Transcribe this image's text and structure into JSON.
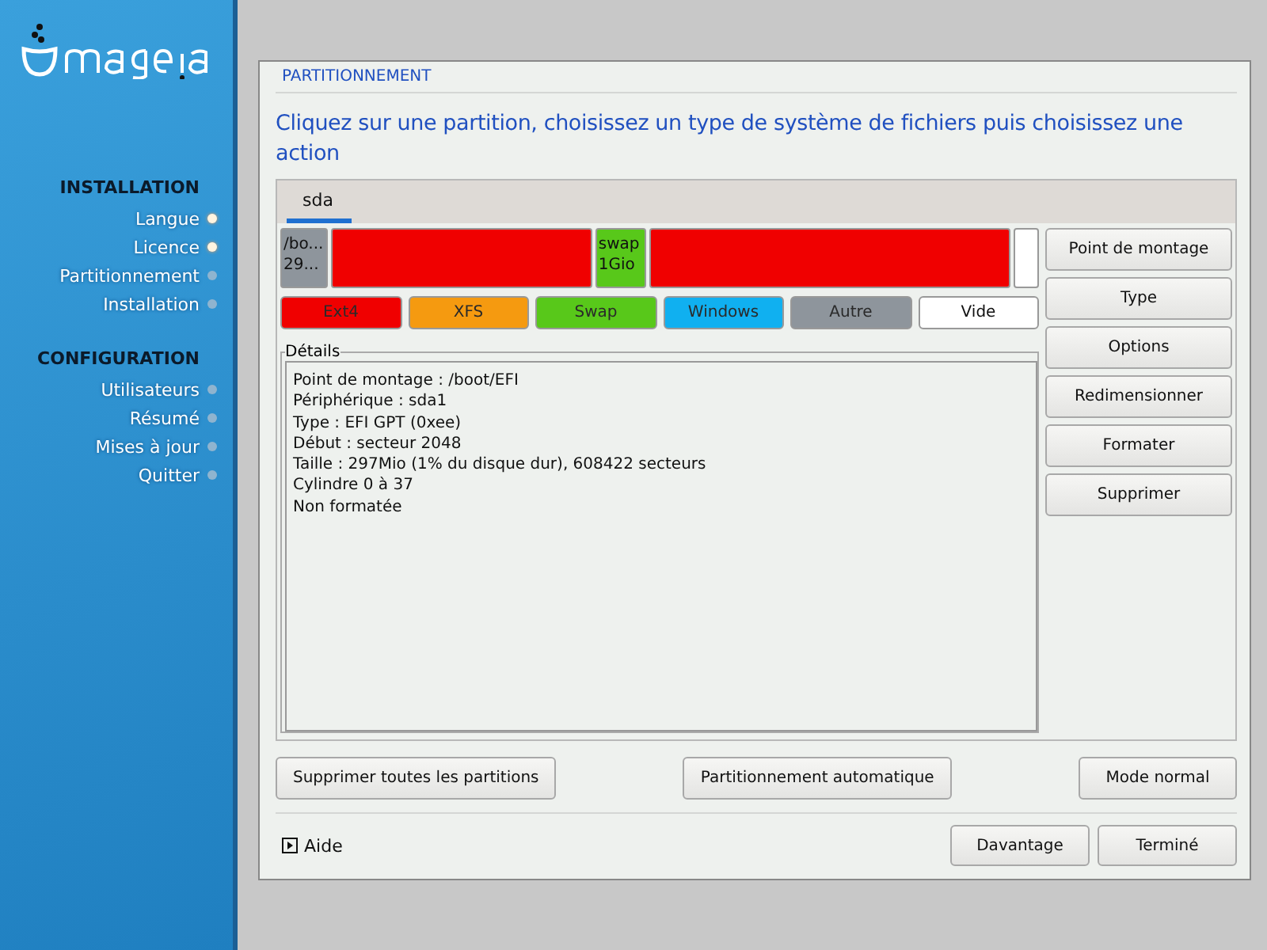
{
  "sidebar": {
    "sections": [
      {
        "title": "INSTALLATION",
        "steps": [
          {
            "label": "Langue",
            "done": true
          },
          {
            "label": "Licence",
            "done": true
          },
          {
            "label": "Partitionnement",
            "done": false
          },
          {
            "label": "Installation",
            "done": false
          }
        ]
      },
      {
        "title": "CONFIGURATION",
        "steps": [
          {
            "label": "Utilisateurs",
            "done": false
          },
          {
            "label": "Résumé",
            "done": false
          },
          {
            "label": "Mises à jour",
            "done": false
          },
          {
            "label": "Quitter",
            "done": false
          }
        ]
      }
    ]
  },
  "dialog": {
    "title": "PARTITIONNEMENT",
    "instruction": "Cliquez sur une partition, choisissez un type de système de fichiers puis choisissez une action",
    "tabs": [
      {
        "label": "sda",
        "selected": true
      }
    ],
    "partitions": [
      {
        "kind": "other",
        "lines": [
          "/bo...",
          "29..."
        ]
      },
      {
        "kind": "ext4"
      },
      {
        "kind": "swap",
        "lines": [
          "swap",
          "1Gio"
        ]
      },
      {
        "kind": "ext4"
      },
      {
        "kind": "empty"
      }
    ],
    "legend": [
      {
        "kind": "ext4",
        "label": "Ext4"
      },
      {
        "kind": "xfs",
        "label": "XFS"
      },
      {
        "kind": "swap",
        "label": "Swap"
      },
      {
        "kind": "windows",
        "label": "Windows"
      },
      {
        "kind": "other",
        "label": "Autre"
      },
      {
        "kind": "empty",
        "label": "Vide"
      }
    ],
    "details_title": "Détails",
    "details": [
      "Point de montage : /boot/EFI",
      "Périphérique : sda1",
      "Type : EFI GPT (0xee)",
      "Début : secteur 2048",
      "Taille : 297Mio (1% du disque dur), 608422 secteurs",
      "Cylindre 0 à 37",
      "Non formatée"
    ],
    "actions": [
      "Point de montage",
      "Type",
      "Options",
      "Redimensionner",
      "Formater",
      "Supprimer"
    ],
    "bottom_buttons": [
      "Supprimer toutes les partitions",
      "Partitionnement automatique",
      "Mode normal"
    ],
    "help": "Aide",
    "footer_buttons": [
      "Davantage",
      "Terminé"
    ]
  }
}
